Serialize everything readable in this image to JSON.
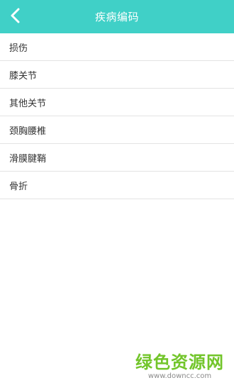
{
  "colors": {
    "header_bg": "#40d0c7",
    "header_text": "#ffffff",
    "divider": "#e3e3e3",
    "watermark_green": "#72c52a"
  },
  "header": {
    "title": "疾病编码",
    "back_icon": "chevron-left-icon"
  },
  "list": {
    "items": [
      {
        "label": "损伤"
      },
      {
        "label": "膝关节"
      },
      {
        "label": "其他关节"
      },
      {
        "label": "颈胸腰椎"
      },
      {
        "label": "滑膜腱鞘"
      },
      {
        "label": "骨折"
      }
    ]
  },
  "watermark": {
    "title": "绿色资源网",
    "url": "www.downcc.com"
  }
}
